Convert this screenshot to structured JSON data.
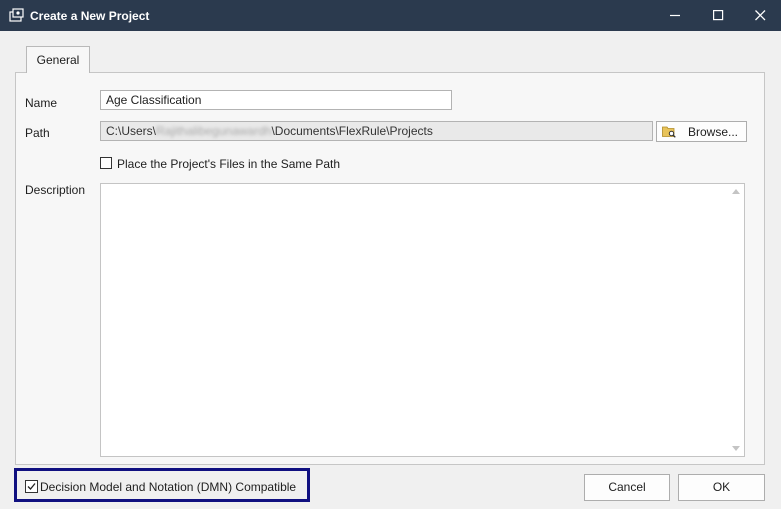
{
  "window": {
    "title": "Create a New Project",
    "icon": "project-icon",
    "controls": [
      "minimize-icon",
      "maximize-icon",
      "close-icon"
    ]
  },
  "tabs": [
    {
      "label": "General",
      "selected": true
    }
  ],
  "form": {
    "name_label": "Name",
    "name_value": "Age Classification",
    "path_label": "Path",
    "path_prefix": "C:\\Users\\",
    "path_blurred": "Rajithalibegunawardh",
    "path_suffix": "\\Documents\\FlexRule\\Projects",
    "browse_label": "Browse...",
    "same_path_label": "Place the Project's Files in the Same Path",
    "same_path_checked": false,
    "description_label": "Description",
    "description_value": ""
  },
  "footer": {
    "dmn_label": "Decision Model and Notation (DMN) Compatible",
    "dmn_checked": true,
    "cancel_label": "Cancel",
    "ok_label": "OK"
  },
  "colors": {
    "titlebar": "#2b3a4e",
    "highlight_border": "#101080",
    "background": "#f0f0f0"
  }
}
